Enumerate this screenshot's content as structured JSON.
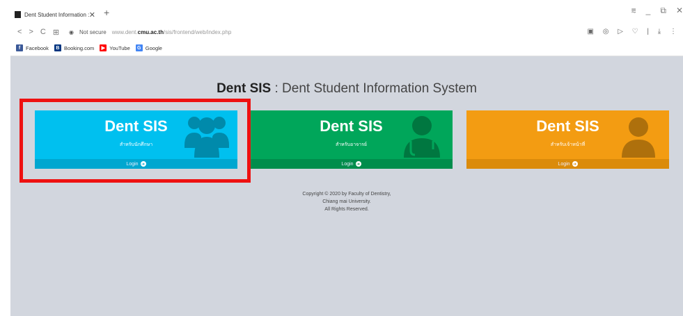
{
  "browser": {
    "tab_title": "Dent Student Information :",
    "close_glyph": "✕",
    "new_tab_glyph": "+",
    "window_controls": [
      "⩳",
      "_",
      "⧉",
      "✕"
    ],
    "not_secure": "Not secure",
    "url_prefix": "www.dent.",
    "url_domain": "cmu.ac.th",
    "url_path": "/sis/frontend/web/index.php",
    "toolbar_icons": "▣ ◎ ▷ ♡ | ⤓ ⋮"
  },
  "bookmarks": [
    {
      "label": "Facebook",
      "icon": "facebook-icon",
      "color": "#3b5998",
      "glyph": "f"
    },
    {
      "label": "Booking.com",
      "icon": "booking-icon",
      "color": "#003580",
      "glyph": "B"
    },
    {
      "label": "YouTube",
      "icon": "youtube-icon",
      "color": "#ff0000",
      "glyph": "▶"
    },
    {
      "label": "Google",
      "icon": "google-icon",
      "color": "#4285f4",
      "glyph": "G"
    }
  ],
  "page": {
    "heading_brand": "Dent SIS",
    "heading_rest": " : Dent Student Information System",
    "boxes": [
      {
        "title": "Dent SIS",
        "subtitle": "สำหรับนักศึกษา",
        "link": "Login",
        "color": "#00c0ef",
        "icon": "users-icon"
      },
      {
        "title": "Dent SIS",
        "subtitle": "สำหรับอาจารย์",
        "link": "Login",
        "color": "#00a65a",
        "icon": "doctor-icon"
      },
      {
        "title": "Dent SIS",
        "subtitle": "สำหรับเจ้าหน้าที่",
        "link": "Login",
        "color": "#f39c12",
        "icon": "user-icon"
      }
    ],
    "copyright": [
      "Copyright © 2020 by Faculty of Dentistry,",
      "Chiang mai University.",
      "All Rights Reserved."
    ]
  }
}
